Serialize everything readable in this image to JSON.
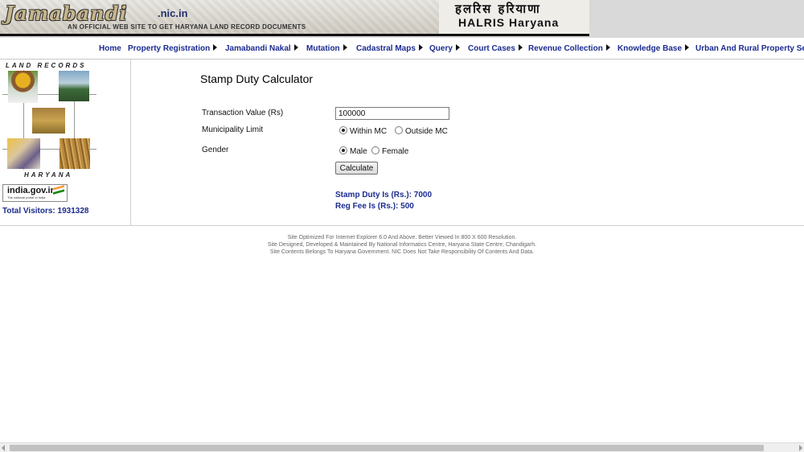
{
  "banner": {
    "logo": "Jamabandi",
    "domain": ".nic.in",
    "subtitle": "AN OFFICIAL WEB SITE TO GET HARYANA LAND RECORD DOCUMENTS",
    "hindi": "हलरिस हरियाणा",
    "halris": "HALRIS Haryana"
  },
  "nav": {
    "items": [
      {
        "label": "Home",
        "submenu": false
      },
      {
        "label": "Property Registration",
        "submenu": true
      },
      {
        "label": "Jamabandi Nakal",
        "submenu": true
      },
      {
        "label": "Mutation",
        "submenu": true
      },
      {
        "label": "Cadastral Maps",
        "submenu": true
      },
      {
        "label": "Query",
        "submenu": true
      },
      {
        "label": "Court Cases",
        "submenu": true
      },
      {
        "label": "Revenue Collection",
        "submenu": true
      },
      {
        "label": "Knowledge Base",
        "submenu": true
      },
      {
        "label": "Urban And Rural Property Se",
        "submenu": false
      }
    ]
  },
  "left": {
    "land_records": "LAND RECORDS",
    "haryana": "HARYANA",
    "india_gov": "india.gov.in",
    "india_gov_small": "The national portal of India",
    "visitors": "Total Visitors: 1931328"
  },
  "calculator": {
    "title": "Stamp Duty Calculator",
    "transaction_label": "Transaction Value (Rs)",
    "transaction_value": "100000",
    "municipality_label": "Municipality Limit",
    "municipality_options": [
      "Within MC",
      "Outside MC"
    ],
    "municipality_selected": "Within MC",
    "gender_label": "Gender",
    "gender_options": [
      "Male",
      "Female"
    ],
    "gender_selected": "Male",
    "button_label": "Calculate",
    "stamp_duty_result": "Stamp Duty Is (Rs.): 7000",
    "reg_fee_result": "Reg Fee Is (Rs.): 500"
  },
  "footer": {
    "line1": "Site Optimized For Internet Explorer 6.0 And Above. Better Viewed In 800 X 600 Resolution.",
    "line2": "Site Designed, Developed & Maintained By National Informatics Centre, Haryana State Centre, Chandigarh.",
    "line3": "Site Contents Belongs To Haryana Government. NIC Does Not Take Responsibility Of Contents And Data."
  },
  "colors": {
    "link": "#1b2b8f",
    "banner_border": "#111111"
  }
}
